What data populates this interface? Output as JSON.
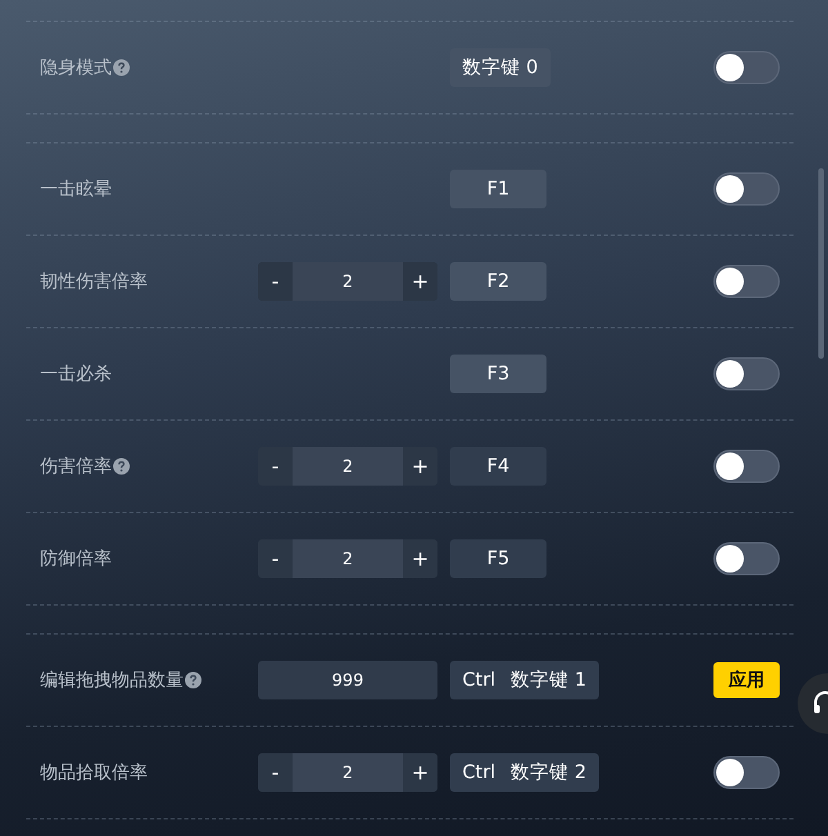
{
  "sections": [
    {
      "rows": [
        {
          "label": "隐身模式",
          "help": true,
          "keys": [
            "数字键 0"
          ],
          "control": {
            "kind": "toggle",
            "on": false
          }
        }
      ]
    },
    {
      "rows": [
        {
          "label": "一击眩晕",
          "help": false,
          "keys": [
            "F1"
          ],
          "control": {
            "kind": "toggle",
            "on": false
          }
        },
        {
          "label": "韧性伤害倍率",
          "help": false,
          "stepper": {
            "minus": "-",
            "value": "2",
            "plus": "+"
          },
          "keys": [
            "F2"
          ],
          "control": {
            "kind": "toggle",
            "on": false
          }
        },
        {
          "label": "一击必杀",
          "help": false,
          "keys": [
            "F3"
          ],
          "control": {
            "kind": "toggle",
            "on": false
          }
        },
        {
          "label": "伤害倍率",
          "help": true,
          "stepper": {
            "minus": "-",
            "value": "2",
            "plus": "+"
          },
          "keys": [
            "F4"
          ],
          "control": {
            "kind": "toggle",
            "on": false
          }
        },
        {
          "label": "防御倍率",
          "help": false,
          "stepper": {
            "minus": "-",
            "value": "2",
            "plus": "+"
          },
          "keys": [
            "F5"
          ],
          "control": {
            "kind": "toggle",
            "on": false
          }
        }
      ]
    },
    {
      "rows": [
        {
          "label": "编辑拖拽物品数量",
          "help": true,
          "input": {
            "value": "999"
          },
          "keys": [
            "Ctrl",
            "数字键 1"
          ],
          "control": {
            "kind": "apply",
            "label": "应用"
          }
        },
        {
          "label": "物品拾取倍率",
          "help": false,
          "stepper": {
            "minus": "-",
            "value": "2",
            "plus": "+"
          },
          "keys": [
            "Ctrl",
            "数字键 2"
          ],
          "control": {
            "kind": "toggle",
            "on": false
          }
        }
      ]
    }
  ]
}
